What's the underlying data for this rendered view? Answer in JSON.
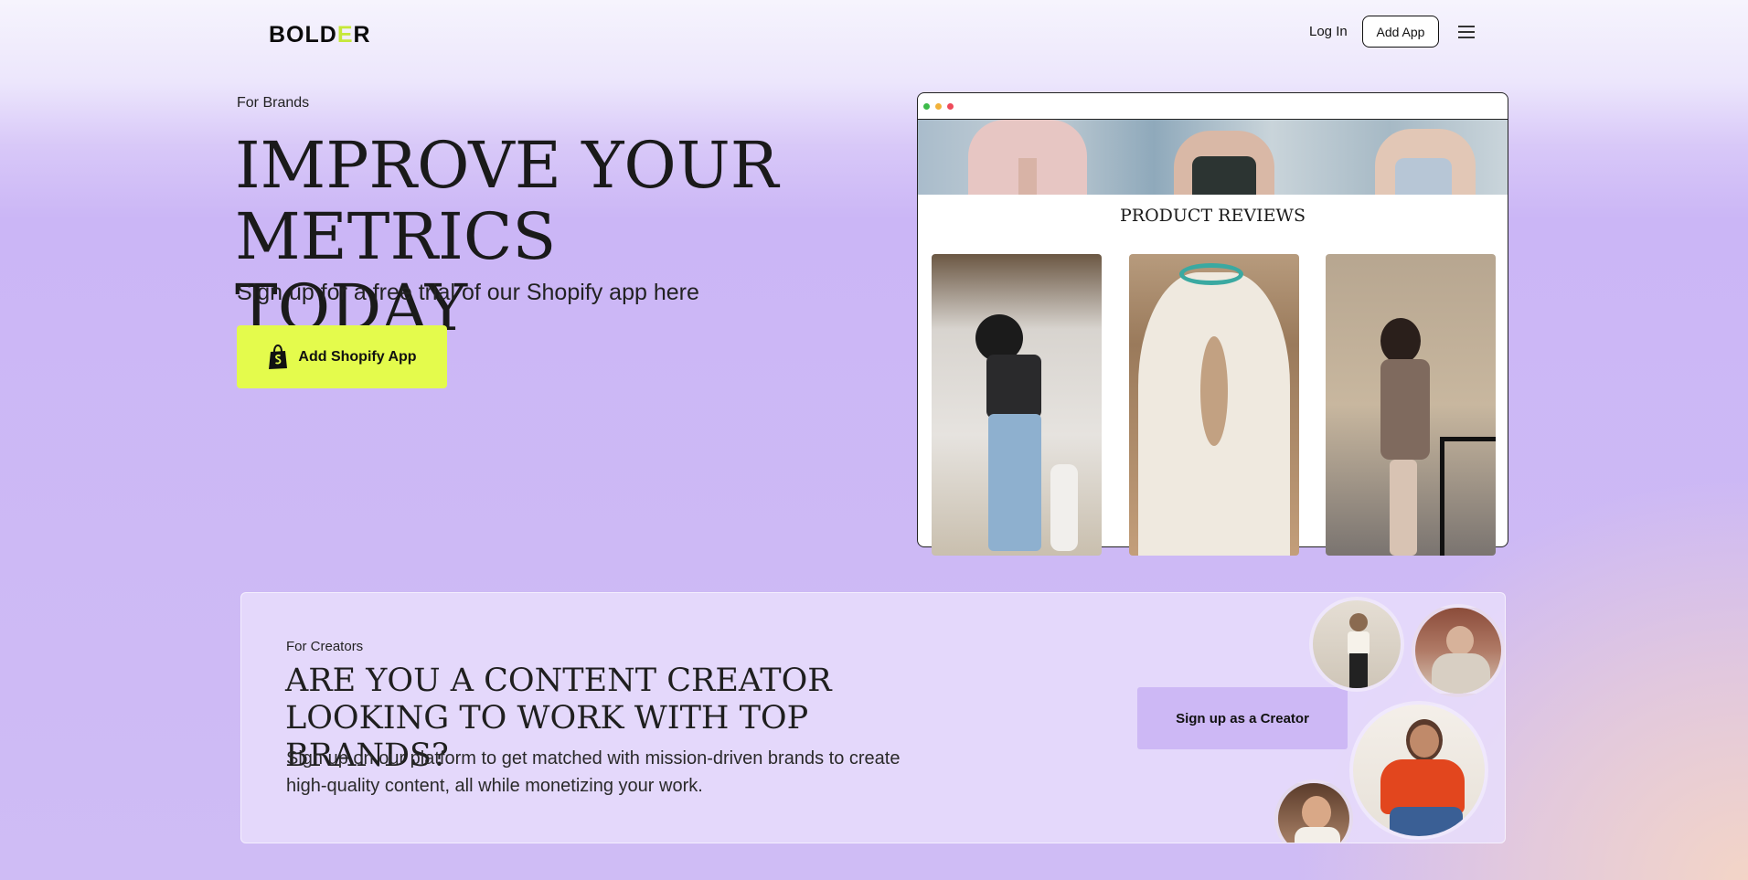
{
  "header": {
    "logo": "BOLD",
    "logo_accent": "E",
    "logo_end": "R",
    "login_label": "Log In",
    "add_app_label": "Add App"
  },
  "hero": {
    "eyebrow": "For Brands",
    "title_line1": "IMPROVE YOUR",
    "title_line2": "METRICS TODAY",
    "subtitle": "Sign up for a free trial of our Shopify app here",
    "cta_label": "Add Shopify App"
  },
  "preview": {
    "section_title": "PRODUCT REVIEWS",
    "dots": [
      "#3dbb4a",
      "#f2b23a",
      "#ee4a5a"
    ]
  },
  "creators": {
    "eyebrow": "For Creators",
    "title": "ARE YOU A CONTENT CREATOR LOOKING TO WORK WITH TOP BRANDS?",
    "body": "Sign up on our platform to get matched with mission-driven brands to create high-quality content, all while monetizing your work.",
    "cta_label": "Sign up as a Creator"
  },
  "colors": {
    "accent_lime": "#e4fb4c",
    "lavender": "#cbb6f6"
  }
}
